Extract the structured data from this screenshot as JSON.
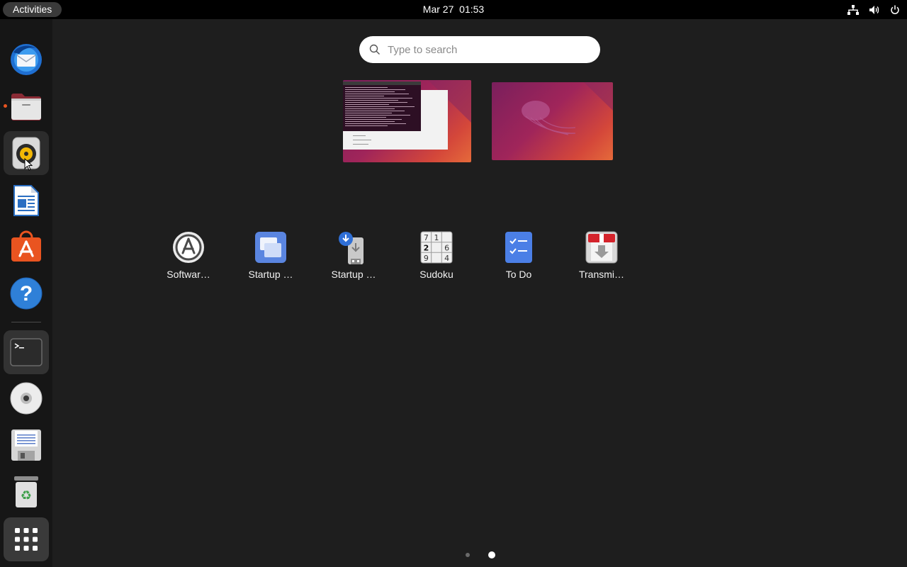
{
  "topbar": {
    "activities": "Activities",
    "date": "Mar 27",
    "time": "01:53",
    "tray_icons": [
      "network-icon",
      "volume-icon",
      "power-icon"
    ]
  },
  "dock": {
    "items": [
      {
        "name": "Thunderbird Mail",
        "icon": "thunderbird-icon",
        "running": false
      },
      {
        "name": "Files",
        "icon": "files-icon",
        "running": true
      },
      {
        "name": "Rhythmbox",
        "icon": "rhythmbox-icon",
        "running": false,
        "hovered": true
      },
      {
        "name": "LibreOffice Writer",
        "icon": "writer-icon",
        "running": false
      },
      {
        "name": "Ubuntu Software",
        "icon": "ubuntu-software-icon",
        "running": false
      },
      {
        "name": "Help",
        "icon": "help-icon",
        "running": false
      },
      {
        "name": "Terminal",
        "icon": "terminal-icon",
        "running": true
      },
      {
        "name": "Disc",
        "icon": "disc-icon",
        "running": false
      },
      {
        "name": "Save",
        "icon": "floppy-icon",
        "running": false
      },
      {
        "name": "Trash",
        "icon": "trash-icon",
        "running": false
      },
      {
        "name": "Show Applications",
        "icon": "app-grid-icon",
        "running": false
      }
    ]
  },
  "search": {
    "placeholder": "Type to search"
  },
  "workspaces": [
    {
      "name": "Workspace 1",
      "has_windows": true
    },
    {
      "name": "Workspace 2",
      "has_windows": false
    }
  ],
  "apps": [
    {
      "label": "Softwar…",
      "icon": "software-updater-icon"
    },
    {
      "label": "Startup …",
      "icon": "startup-applications-icon"
    },
    {
      "label": "Startup …",
      "icon": "startup-disk-creator-icon"
    },
    {
      "label": "Sudoku",
      "icon": "sudoku-icon"
    },
    {
      "label": "To Do",
      "icon": "todo-icon"
    },
    {
      "label": "Transmi…",
      "icon": "transmission-icon"
    }
  ],
  "sudoku_digits": [
    "7",
    "1",
    "2",
    "6",
    "9",
    "4"
  ],
  "pagination": {
    "total": 2,
    "current": 2
  },
  "colors": {
    "accent": "#e95420",
    "panel": "#000000",
    "dock": "#161616",
    "background": "#1e1e1e"
  }
}
